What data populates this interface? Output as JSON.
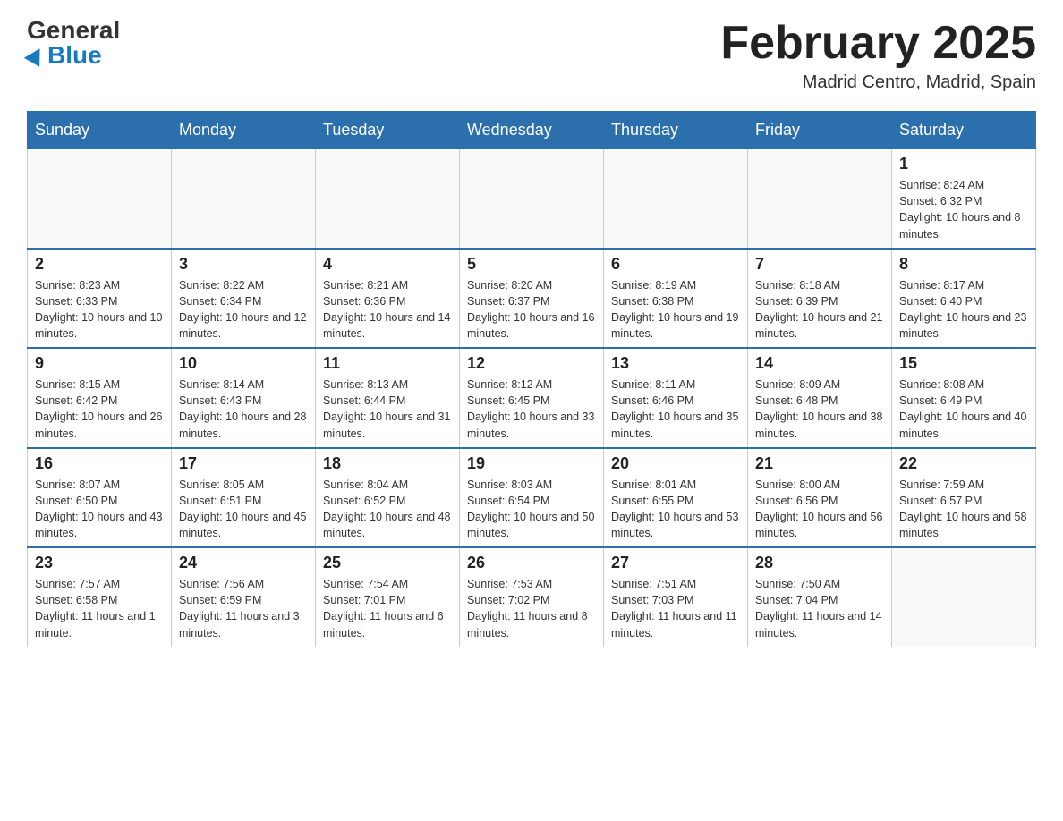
{
  "header": {
    "logo_general": "General",
    "logo_blue": "Blue",
    "month_title": "February 2025",
    "location": "Madrid Centro, Madrid, Spain"
  },
  "days_of_week": [
    "Sunday",
    "Monday",
    "Tuesday",
    "Wednesday",
    "Thursday",
    "Friday",
    "Saturday"
  ],
  "weeks": [
    [
      {
        "day": "",
        "info": ""
      },
      {
        "day": "",
        "info": ""
      },
      {
        "day": "",
        "info": ""
      },
      {
        "day": "",
        "info": ""
      },
      {
        "day": "",
        "info": ""
      },
      {
        "day": "",
        "info": ""
      },
      {
        "day": "1",
        "info": "Sunrise: 8:24 AM\nSunset: 6:32 PM\nDaylight: 10 hours and 8 minutes."
      }
    ],
    [
      {
        "day": "2",
        "info": "Sunrise: 8:23 AM\nSunset: 6:33 PM\nDaylight: 10 hours and 10 minutes."
      },
      {
        "day": "3",
        "info": "Sunrise: 8:22 AM\nSunset: 6:34 PM\nDaylight: 10 hours and 12 minutes."
      },
      {
        "day": "4",
        "info": "Sunrise: 8:21 AM\nSunset: 6:36 PM\nDaylight: 10 hours and 14 minutes."
      },
      {
        "day": "5",
        "info": "Sunrise: 8:20 AM\nSunset: 6:37 PM\nDaylight: 10 hours and 16 minutes."
      },
      {
        "day": "6",
        "info": "Sunrise: 8:19 AM\nSunset: 6:38 PM\nDaylight: 10 hours and 19 minutes."
      },
      {
        "day": "7",
        "info": "Sunrise: 8:18 AM\nSunset: 6:39 PM\nDaylight: 10 hours and 21 minutes."
      },
      {
        "day": "8",
        "info": "Sunrise: 8:17 AM\nSunset: 6:40 PM\nDaylight: 10 hours and 23 minutes."
      }
    ],
    [
      {
        "day": "9",
        "info": "Sunrise: 8:15 AM\nSunset: 6:42 PM\nDaylight: 10 hours and 26 minutes."
      },
      {
        "day": "10",
        "info": "Sunrise: 8:14 AM\nSunset: 6:43 PM\nDaylight: 10 hours and 28 minutes."
      },
      {
        "day": "11",
        "info": "Sunrise: 8:13 AM\nSunset: 6:44 PM\nDaylight: 10 hours and 31 minutes."
      },
      {
        "day": "12",
        "info": "Sunrise: 8:12 AM\nSunset: 6:45 PM\nDaylight: 10 hours and 33 minutes."
      },
      {
        "day": "13",
        "info": "Sunrise: 8:11 AM\nSunset: 6:46 PM\nDaylight: 10 hours and 35 minutes."
      },
      {
        "day": "14",
        "info": "Sunrise: 8:09 AM\nSunset: 6:48 PM\nDaylight: 10 hours and 38 minutes."
      },
      {
        "day": "15",
        "info": "Sunrise: 8:08 AM\nSunset: 6:49 PM\nDaylight: 10 hours and 40 minutes."
      }
    ],
    [
      {
        "day": "16",
        "info": "Sunrise: 8:07 AM\nSunset: 6:50 PM\nDaylight: 10 hours and 43 minutes."
      },
      {
        "day": "17",
        "info": "Sunrise: 8:05 AM\nSunset: 6:51 PM\nDaylight: 10 hours and 45 minutes."
      },
      {
        "day": "18",
        "info": "Sunrise: 8:04 AM\nSunset: 6:52 PM\nDaylight: 10 hours and 48 minutes."
      },
      {
        "day": "19",
        "info": "Sunrise: 8:03 AM\nSunset: 6:54 PM\nDaylight: 10 hours and 50 minutes."
      },
      {
        "day": "20",
        "info": "Sunrise: 8:01 AM\nSunset: 6:55 PM\nDaylight: 10 hours and 53 minutes."
      },
      {
        "day": "21",
        "info": "Sunrise: 8:00 AM\nSunset: 6:56 PM\nDaylight: 10 hours and 56 minutes."
      },
      {
        "day": "22",
        "info": "Sunrise: 7:59 AM\nSunset: 6:57 PM\nDaylight: 10 hours and 58 minutes."
      }
    ],
    [
      {
        "day": "23",
        "info": "Sunrise: 7:57 AM\nSunset: 6:58 PM\nDaylight: 11 hours and 1 minute."
      },
      {
        "day": "24",
        "info": "Sunrise: 7:56 AM\nSunset: 6:59 PM\nDaylight: 11 hours and 3 minutes."
      },
      {
        "day": "25",
        "info": "Sunrise: 7:54 AM\nSunset: 7:01 PM\nDaylight: 11 hours and 6 minutes."
      },
      {
        "day": "26",
        "info": "Sunrise: 7:53 AM\nSunset: 7:02 PM\nDaylight: 11 hours and 8 minutes."
      },
      {
        "day": "27",
        "info": "Sunrise: 7:51 AM\nSunset: 7:03 PM\nDaylight: 11 hours and 11 minutes."
      },
      {
        "day": "28",
        "info": "Sunrise: 7:50 AM\nSunset: 7:04 PM\nDaylight: 11 hours and 14 minutes."
      },
      {
        "day": "",
        "info": ""
      }
    ]
  ]
}
